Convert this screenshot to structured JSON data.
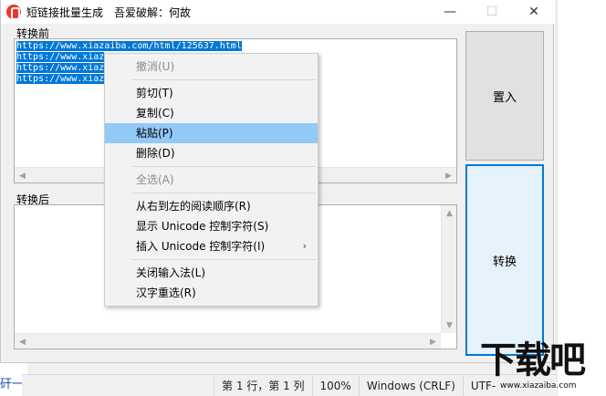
{
  "window": {
    "title": "短链接批量生成　吾爱破解：何故",
    "minimize_glyph": "—",
    "maximize_glyph": "☐",
    "close_glyph": "✕"
  },
  "before_section": {
    "label": "转换前",
    "lines": [
      "https://www.xiazaiba.com/html/125637.html",
      "https://www.xiaz",
      "https://www.xiaz",
      "https://www.xiaz"
    ]
  },
  "after_section": {
    "label": "转换后"
  },
  "buttons": {
    "import_label": "置入",
    "convert_label": "转换"
  },
  "context_menu": {
    "items": [
      {
        "label": "撤消(U)",
        "enabled": false
      },
      {
        "separator": true
      },
      {
        "label": "剪切(T)",
        "enabled": true
      },
      {
        "label": "复制(C)",
        "enabled": true
      },
      {
        "label": "粘贴(P)",
        "enabled": true,
        "highlighted": true
      },
      {
        "label": "删除(D)",
        "enabled": true
      },
      {
        "separator": true
      },
      {
        "label": "全选(A)",
        "enabled": false
      },
      {
        "separator": true
      },
      {
        "label": "从右到左的阅读顺序(R)",
        "enabled": true
      },
      {
        "label": "显示 Unicode 控制字符(S)",
        "enabled": true
      },
      {
        "label": "插入 Unicode 控制字符(I)",
        "enabled": true,
        "submenu": true
      },
      {
        "separator": true
      },
      {
        "label": "关闭输入法(L)",
        "enabled": true
      },
      {
        "label": "汉字重选(R)",
        "enabled": true
      }
    ],
    "submenu_glyph": "›"
  },
  "statusbar": {
    "position": "第 1 行，第 1 列",
    "zoom": "100%",
    "line_ending": "Windows (CRLF)",
    "encoding": "UTF-"
  },
  "background": {
    "left_text": "矸一"
  },
  "watermark": {
    "logo": "下载吧",
    "url": "www.xiazaiba.com"
  },
  "colors": {
    "selection": "#0078d7",
    "menu_highlight": "#91c9f7",
    "focus_border": "#0078d7",
    "app_icon": "#e8382b"
  }
}
